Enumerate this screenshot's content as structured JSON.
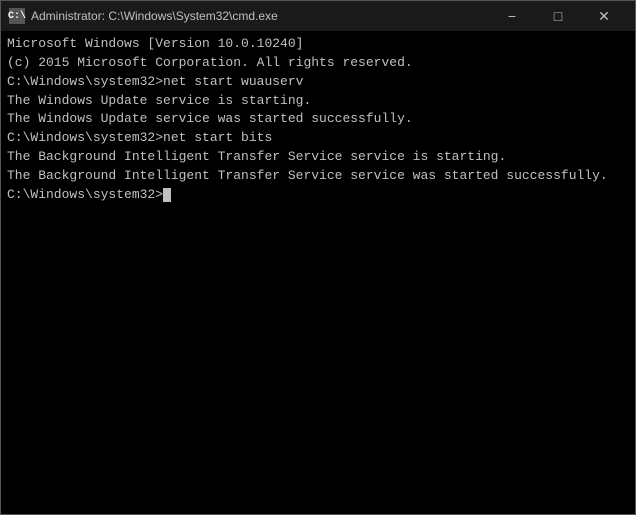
{
  "titleBar": {
    "icon": "C:\\",
    "text": "Administrator: C:\\Windows\\System32\\cmd.exe",
    "minimizeLabel": "−",
    "maximizeLabel": "□",
    "closeLabel": "✕"
  },
  "console": {
    "lines": [
      "Microsoft Windows [Version 10.0.10240]",
      "(c) 2015 Microsoft Corporation. All rights reserved.",
      "",
      "C:\\Windows\\system32>net start wuauserv",
      "The Windows Update service is starting.",
      "The Windows Update service was started successfully.",
      "",
      "",
      "C:\\Windows\\system32>net start bits",
      "The Background Intelligent Transfer Service service is starting.",
      "The Background Intelligent Transfer Service service was started successfully.",
      "",
      "",
      "C:\\Windows\\system32>"
    ]
  }
}
